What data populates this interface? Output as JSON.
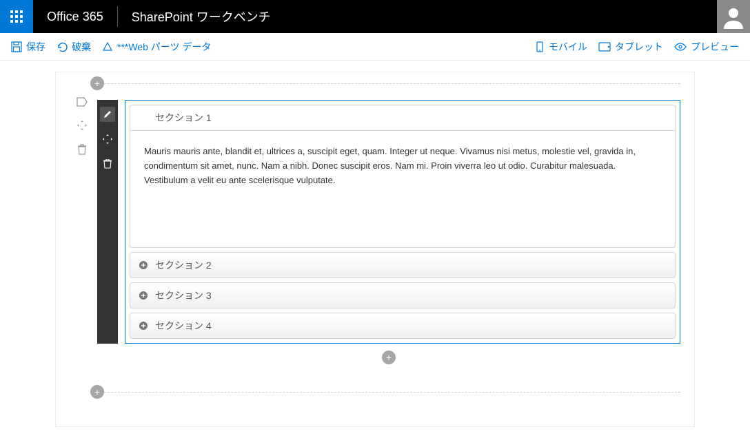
{
  "header": {
    "office_title": "Office 365",
    "app_name": "SharePoint ワークベンチ"
  },
  "commandbar": {
    "save": "保存",
    "discard": "破棄",
    "webpart_data": "***Web パーツ データ",
    "mobile": "モバイル",
    "tablet": "タブレット",
    "preview": "プレビュー"
  },
  "accordion": {
    "sections": [
      {
        "title": "セクション 1",
        "open": true,
        "body": "Mauris mauris ante, blandit et, ultrices a, suscipit eget, quam. Integer ut neque. Vivamus nisi metus, molestie vel, gravida in, condimentum sit amet, nunc. Nam a nibh. Donec suscipit eros. Nam mi. Proin viverra leo ut odio. Curabitur malesuada. Vestibulum a velit eu ante scelerisque vulputate."
      },
      {
        "title": "セクション 2",
        "open": false
      },
      {
        "title": "セクション 3",
        "open": false
      },
      {
        "title": "セクション 4",
        "open": false
      }
    ]
  }
}
